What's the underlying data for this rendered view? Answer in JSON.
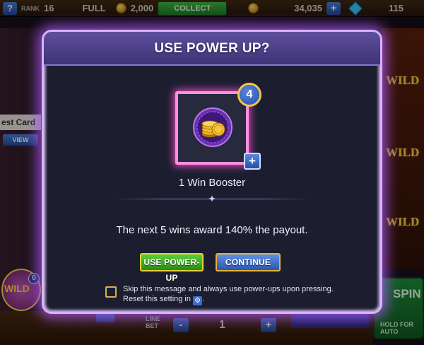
{
  "topbar": {
    "help_label": "?",
    "rank_label": "RANK",
    "rank_value": "16",
    "full_label": "FULL",
    "coin_amount": "2,000",
    "collect_label": "COLLECT",
    "coins_total": "34,035",
    "add_label": "+",
    "gems": "115"
  },
  "left_panel": {
    "quest_label": "est Card",
    "view_label": "VIEW",
    "wild_badge_label": "WILD",
    "badge_count": "0"
  },
  "reels": {
    "wild_label": "WILD"
  },
  "bottom": {
    "line_bet_label": "LINE BET",
    "minus_label": "-",
    "plus_label": "+",
    "bet_value": "1",
    "spin_label": "SPIN",
    "hold_label": "HOLD FOR AUTO"
  },
  "dialog": {
    "title": "USE POWER UP?",
    "item_count": "4",
    "plus_label": "+",
    "item_name": "1 Win Booster",
    "description": "The next 5 wins award 140% the payout.",
    "use_button": "USE POWER-UP",
    "continue_button": "CONTINUE",
    "skip_line1": "Skip this message and always use power-ups upon pressing.",
    "skip_line2": "Reset this setting in",
    "skip_line2_end": ".",
    "settings_icon": "gear-icon",
    "checkbox_checked": false
  },
  "colors": {
    "dialog_glow": "#b05cff",
    "header": "#4f4189",
    "item_border": "#ff8fe0",
    "use_button": "#3fae28",
    "continue_button": "#3f6fc8"
  }
}
